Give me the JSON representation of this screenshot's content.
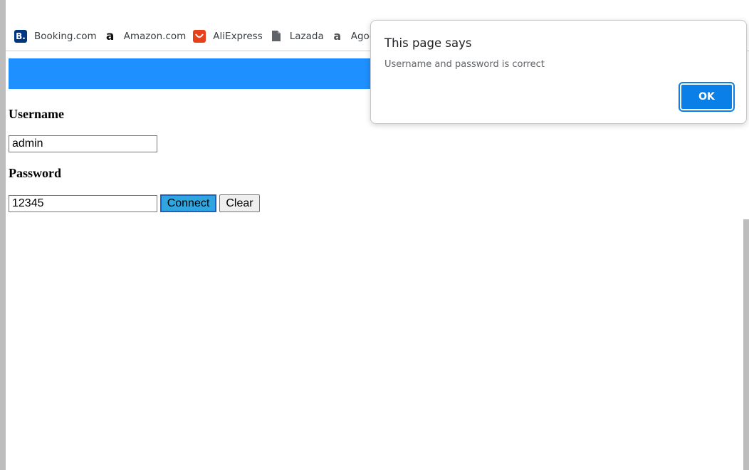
{
  "bookmarks": [
    {
      "label": "Booking.com",
      "icon": "booking-icon"
    },
    {
      "label": "Amazon.com",
      "icon": "amazon-icon"
    },
    {
      "label": "AliExpress",
      "icon": "aliexpress-icon"
    },
    {
      "label": "Lazada",
      "icon": "page-icon"
    },
    {
      "label": "Agod",
      "icon": "agoda-icon"
    }
  ],
  "form": {
    "username_label": "Username",
    "username_value": "admin",
    "password_label": "Password",
    "password_value": "12345",
    "connect_label": "Connect",
    "clear_label": "Clear"
  },
  "dialog": {
    "title": "This page says",
    "message": "Username and password is correct",
    "ok_label": "OK"
  },
  "colors": {
    "banner": "#1e90ff",
    "connect_button": "#2fa6e0",
    "dialog_ok": "#0b7fe8"
  }
}
